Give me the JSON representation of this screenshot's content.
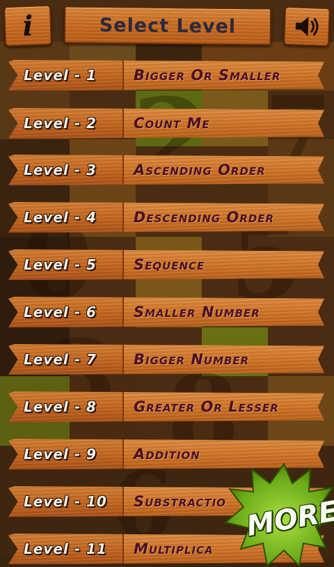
{
  "header": {
    "info_icon_glyph": "i",
    "title": "Select Level",
    "sound_icon": "speaker-icon"
  },
  "levels": [
    {
      "number": "Level - 1",
      "name": "Bigger Or Smaller"
    },
    {
      "number": "Level - 2",
      "name": "Count Me"
    },
    {
      "number": "Level - 3",
      "name": "Ascending Order"
    },
    {
      "number": "Level - 4",
      "name": "Descending Order"
    },
    {
      "number": "Level - 5",
      "name": "Sequence"
    },
    {
      "number": "Level - 6",
      "name": "Smaller Number"
    },
    {
      "number": "Level - 7",
      "name": "Bigger Number"
    },
    {
      "number": "Level - 8",
      "name": "Greater Or Lesser"
    },
    {
      "number": "Level - 9",
      "name": "Addition"
    },
    {
      "number": "Level - 10",
      "name": "Substractio"
    },
    {
      "number": "Level - 11",
      "name": "Multiplica"
    }
  ],
  "more_badge": {
    "label": "MORE",
    "color": "#7dbb1e"
  },
  "colors": {
    "wood_light": "#e08e44",
    "wood_dark": "#a9511a",
    "level_name_text": "#4a1026",
    "level_number_text": "#f4efe8"
  }
}
